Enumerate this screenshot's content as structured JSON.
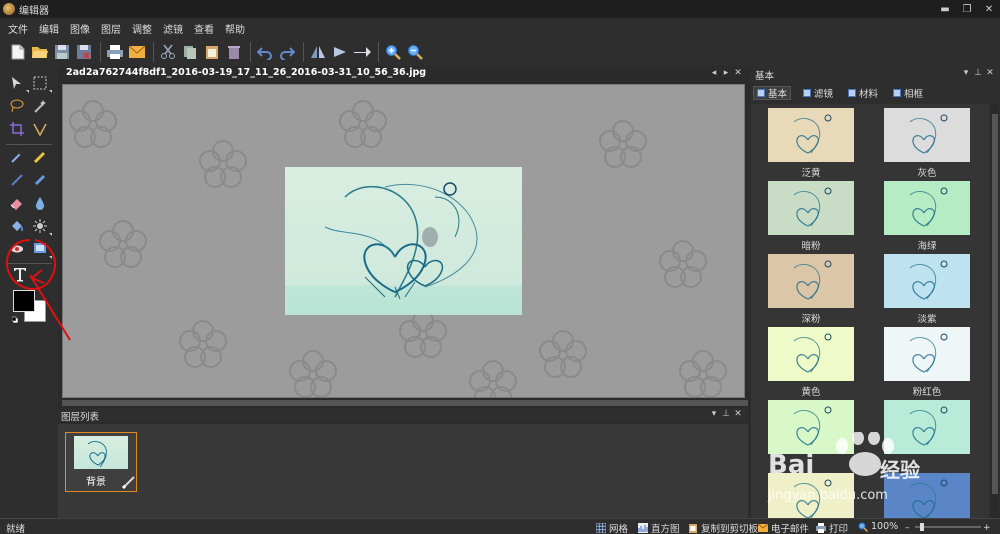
{
  "window": {
    "title": "编辑器",
    "controls": [
      "▬",
      "❐",
      "✕"
    ]
  },
  "menu": [
    "文件",
    "编辑",
    "图像",
    "图层",
    "调整",
    "滤镜",
    "查看",
    "帮助"
  ],
  "document": {
    "tab_title": "2ad2a762744f8df1_2016-03-19_17_11_26_2016-03-31_10_56_36.jpg"
  },
  "layers_panel": {
    "title": "图层列表",
    "layers": [
      {
        "name": "背景"
      }
    ]
  },
  "right_panel": {
    "title": "基本",
    "tabs": [
      "基本",
      "滤镜",
      "材料",
      "相框"
    ],
    "active_tab": "基本",
    "presets": [
      {
        "label": "泛黄",
        "color": "#e8d9b8"
      },
      {
        "label": "灰色",
        "color": "#dcdcdc"
      },
      {
        "label": "暗粉",
        "color": "#c9dcc6"
      },
      {
        "label": "海绿",
        "color": "#b6ecc4"
      },
      {
        "label": "深粉",
        "color": "#dcc6a8"
      },
      {
        "label": "淡紫",
        "color": "#bfe2f0"
      },
      {
        "label": "黄色",
        "color": "#eefac8"
      },
      {
        "label": "粉红色",
        "color": "#eef6f8"
      },
      {
        "label": "",
        "color": "#d8f8c8"
      },
      {
        "label": "",
        "color": "#b8ecd8"
      },
      {
        "label": "",
        "color": "#f0f0c8"
      },
      {
        "label": "",
        "color": "#5a86c8"
      }
    ]
  },
  "watermark": {
    "brand": "Bai",
    "sub": "经验",
    "url": "jingyan.baidu.com"
  },
  "status": {
    "ready": "就绪",
    "grid": "网格",
    "histogram": "直方图",
    "copy": "复制到剪切板",
    "email": "电子邮件",
    "print": "打印",
    "zoom": "100%"
  }
}
